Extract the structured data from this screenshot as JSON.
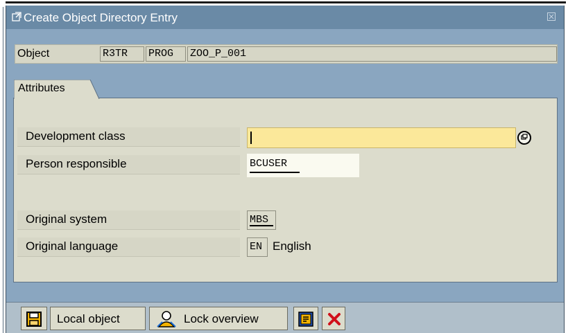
{
  "window": {
    "title": "Create Object Directory Entry",
    "title_icon": "new-window-icon",
    "close_icon": "close-icon"
  },
  "object": {
    "label": "Object",
    "pgmid": "R3TR",
    "type": "PROG",
    "name": "ZOO_P_001"
  },
  "attributes": {
    "tab_label": "Attributes",
    "development_class": {
      "label": "Development class",
      "value": "",
      "f4_icon": "value-help-icon"
    },
    "person_responsible": {
      "label": "Person responsible",
      "value": "BCUSER"
    },
    "original_system": {
      "label": "Original system",
      "value": "MBS"
    },
    "original_language": {
      "label": "Original language",
      "code": "EN",
      "text": "English"
    }
  },
  "toolbar": {
    "save_icon": "save-icon",
    "local_object_label": "Local object",
    "lock_overview_label": "Lock overview",
    "lock_overview_icon": "user-lock-icon",
    "other_icon": "display-object-icon",
    "cancel_icon": "cancel-icon"
  },
  "colors": {
    "window_bg": "#8aa6c0",
    "titlebar_bg": "#6a8aa6",
    "required_field": "#fbe89a",
    "group_bg": "#dcdccc"
  }
}
